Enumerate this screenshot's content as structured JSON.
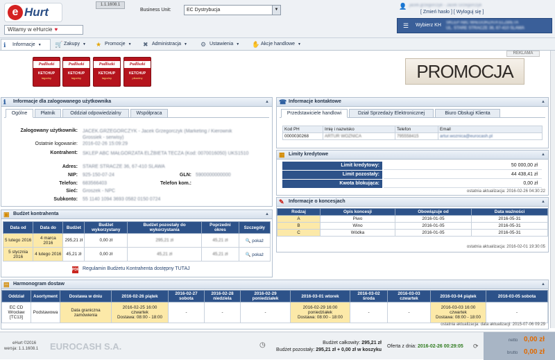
{
  "app": {
    "logo_letter": "e",
    "logo_text": "Hurt",
    "version": "1.1.1608.1",
    "welcome": "Witamy w eHurcie",
    "heart": "♥"
  },
  "business_unit": {
    "label": "Business Unit:",
    "value": "EC Dystrybucja"
  },
  "user": {
    "name": "jacek.grzegorczyk - Jacek Grzegorczyk",
    "change_password": "[ Zmień hasło ]",
    "logout": "[ Wyloguj się ]"
  },
  "kh": {
    "label": "Wybierz KH",
    "value_line1": "SKLEP ABC MAŁGORZATA ELZBIETA",
    "value_line2": "UL. STARE STRACZE 36, 67-410 SLAWA"
  },
  "menu": [
    {
      "label": "Informacje",
      "icon": "info-icon"
    },
    {
      "label": "Zakupy",
      "icon": "cart-icon"
    },
    {
      "label": "Promocje",
      "icon": "star-icon"
    },
    {
      "label": "Administracja",
      "icon": "tools-icon"
    },
    {
      "label": "Ustawienia",
      "icon": "gear-icon"
    },
    {
      "label": "Akcje handlowe",
      "icon": "handshake-icon"
    }
  ],
  "promo": {
    "reklama": "REKLAMA",
    "banner": "PROMOCJA",
    "products": [
      {
        "brand": "Pudliszki",
        "name": "KETCHUP",
        "sub": "łagodny"
      },
      {
        "brand": "Pudliszki",
        "name": "KETCHUP",
        "sub": "łagodny"
      },
      {
        "brand": "Pudliszki",
        "name": "KETCHUP",
        "sub": "łagodny"
      },
      {
        "brand": "Pudliszki",
        "name": "KETCHUP",
        "sub": "pikantny"
      }
    ]
  },
  "user_panel": {
    "title": "Informacje dla zalogowanego użytkownika",
    "tabs": [
      "Ogólne",
      "Płatnik",
      "Oddział odpowiedzialny",
      "Współpraca"
    ],
    "fields": [
      {
        "label": "Zalogowany użytkownik:",
        "value": "JACEK.GRZEGORCZYK - Jacek Grzegorczyk (Marketing / Kierownik Grossiek - serwisy)"
      },
      {
        "label": "Ostatnie logowanie:",
        "value": "2016-02-26 15:09:29"
      },
      {
        "label": "Kontrahent:",
        "value": "SKLEP ABC MAŁGORZATA ELŻBIETA TECZA (Kod: 0070016050) UKS1510"
      },
      {
        "label": "Adres:",
        "value": "STARE STRACZE 36, 67-410 SLAWA"
      },
      {
        "label": "NIP:",
        "value": "925-150-07-24"
      },
      {
        "label": "Telefon:",
        "value": "683566403"
      },
      {
        "label": "Sieć:",
        "value": "Groszek - NPC"
      },
      {
        "label": "Subkonto:",
        "value": "55 1140 1094 3693 0582 0150 0724"
      }
    ],
    "gln_label": "GLN:",
    "gln_value": "5900000000000",
    "tel_kom_label": "Telefon kom.:",
    "tel_kom_value": ""
  },
  "budget": {
    "title": "Budżet kontrahenta",
    "headers": [
      "Data od",
      "Data do",
      "Budżet",
      "Budżet wykorzystany",
      "Budżet pozostały do wykorzystania",
      "Poprzedni okres",
      "Szczegóły"
    ],
    "rows": [
      {
        "od": "5 lutego 2016",
        "do": "4 marca 2016",
        "budzet": "295,21 zł",
        "wykorzystany": "0,00 zł",
        "pozostaly": "295,21 zł",
        "poprzedni": "45,21 zł",
        "link": "pokaż"
      },
      {
        "od": "5 stycznia 2016",
        "do": "4 lutego 2016",
        "budzet": "45,21 zł",
        "wykorzystany": "0,00 zł",
        "pozostaly": "45,21 zł",
        "poprzedni": "45,21 zł",
        "link": "pokaż"
      }
    ],
    "regulamin": "Regulamin Budżetu Kontrahenta dostępny TUTAJ",
    "pdf": "PDF"
  },
  "contact": {
    "title": "Informacje kontaktowe",
    "tabs": [
      "Przedstawiciele handlowi",
      "Dział Sprzedaży Elektronicznej",
      "Biuro Obsługi Klienta"
    ],
    "headers": [
      "Kod PH",
      "Imię i nazwisko",
      "Telefon",
      "Email"
    ],
    "row": {
      "kod": "0000030268",
      "name": "ARTUR WOZNICA",
      "tel": "795558415",
      "email": "artur.woznica@eurocash.pl"
    }
  },
  "limits": {
    "title": "Limity kredytowe",
    "rows": [
      {
        "label": "Limit kredytowy:",
        "value": "50 000,00 zł"
      },
      {
        "label": "Limit pozostały:",
        "value": "44 438,41 zł"
      },
      {
        "label": "Kwota blokująca:",
        "value": "0,00 zł"
      }
    ],
    "update": "ostatnia aktualizacja: 2016-02-26 04:30:22"
  },
  "concessions": {
    "title": "Informacje o koncesjach",
    "headers": [
      "Rodzaj",
      "Opis koncesji",
      "Obowiązuje od",
      "Data ważności"
    ],
    "rows": [
      {
        "rodzaj": "A",
        "opis": "Piwo",
        "od": "2016-01-05",
        "do": "2016-05-31"
      },
      {
        "rodzaj": "B",
        "opis": "Wino",
        "od": "2016-01-05",
        "do": "2016-05-31"
      },
      {
        "rodzaj": "C",
        "opis": "Wódka",
        "od": "2016-01-05",
        "do": "2016-05-31"
      }
    ],
    "update": "ostatnia aktualizacja: 2016-02-01 19:30:05"
  },
  "schedule": {
    "title": "Harmonogram dostaw",
    "headers": [
      "Oddział",
      "Asortyment",
      "Dostawa w dniu",
      "2016-02-26 piątek",
      "2016-02-27 sobota",
      "2016-02-28 niedziela",
      "2016-02-29 poniedziałek",
      "2016-03-01 wtorek",
      "2016-03-02 środa",
      "2016-03-03 czwartek",
      "2016-03-04 piątek",
      "2016-03-05 sobota"
    ],
    "row": {
      "oddzial": "EC CD Wrocław [TC13]",
      "asortyment": "Podstawowa",
      "dostawa": "Data graniczna zamówienia",
      "cells": [
        {
          "l1": "2016-02-25 16:00",
          "l2": "czwartek",
          "l3": "Dostawa: 08:00 - 18:00",
          "yel": true
        },
        {
          "l1": "-",
          "l2": "",
          "l3": "",
          "yel": false
        },
        {
          "l1": "-",
          "l2": "",
          "l3": "",
          "yel": false
        },
        {
          "l1": "-",
          "l2": "",
          "l3": "",
          "yel": false
        },
        {
          "l1": "2016-02-29 16:00",
          "l2": "poniedziałek",
          "l3": "Dostawa: 08:00 - 18:00",
          "yel": true
        },
        {
          "l1": "-",
          "l2": "",
          "l3": "",
          "yel": false
        },
        {
          "l1": "-",
          "l2": "",
          "l3": "",
          "yel": false
        },
        {
          "l1": "2016-03-03 16:00",
          "l2": "czwartek",
          "l3": "Dostawa: 08:00 - 18:00",
          "yel": true
        },
        {
          "l1": "-",
          "l2": "",
          "l3": "",
          "yel": false
        }
      ]
    },
    "update": "ostatnia aktualizacja: data aktualizacji: 2015-07-06 09:29"
  },
  "footer": {
    "app": "eHurt ©2016",
    "version": "wersja: 1.1.1608.1",
    "company": "EUROCASH S.A.",
    "budget_total_label": "Budżet całkowity:",
    "budget_total": "295,21 zł",
    "budget_left_label": "Budżet pozostały:",
    "budget_left": "295,21 zł + 0,00 zł w koszyku",
    "offer_label": "Oferta z dnia:",
    "offer_date": "2016-02-26 00:29:05",
    "netto_label": "netto",
    "netto": "0,00 zł",
    "brutto_label": "brutto",
    "brutto": "0,00 zł"
  }
}
